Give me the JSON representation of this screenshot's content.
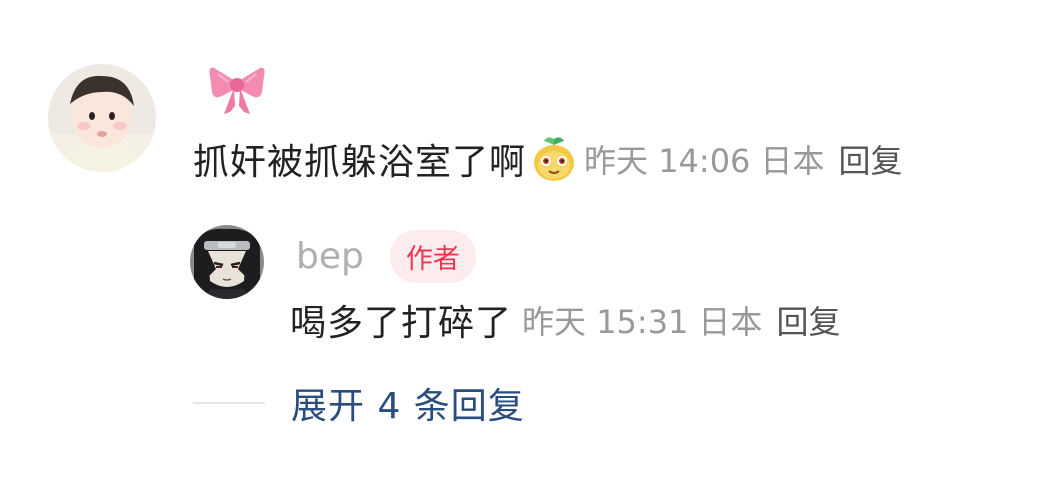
{
  "comment": {
    "username_icon": "pink-ribbon-bow-emoji",
    "text": "抓奸被抓躲浴室了啊",
    "inline_emoji": "yellow-fruit-face-emoji",
    "time": "昨天 14:06",
    "location": "日本",
    "reply_label": "回复"
  },
  "reply": {
    "username": "bep",
    "badge": "作者",
    "text": "喝多了打碎了",
    "time": "昨天 15:31",
    "location": "日本",
    "reply_label": "回复"
  },
  "expand": {
    "label": "展开 4 条回复"
  },
  "colors": {
    "badge_bg": "#fdecee",
    "badge_text": "#f0354f",
    "expand_link": "#2a4d7f",
    "meta_gray": "#999999"
  }
}
